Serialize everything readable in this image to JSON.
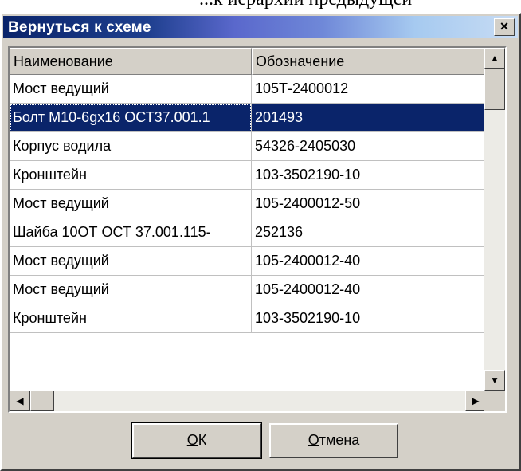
{
  "background_text": "...к иерархии предыдущей",
  "dialog": {
    "title": "Вернуться к схеме",
    "close_glyph": "×"
  },
  "table": {
    "columns": [
      "Наименование",
      "Обозначение"
    ],
    "rows": [
      {
        "name": "Мост ведущий",
        "code": "105Т-2400012"
      },
      {
        "name": "Болт М10-6gх16 ОСТ37.001.1",
        "code": "201493"
      },
      {
        "name": "Корпус водила",
        "code": "54326-2405030"
      },
      {
        "name": "Кронштейн",
        "code": "103-3502190-10"
      },
      {
        "name": "Мост ведущий",
        "code": "105-2400012-50"
      },
      {
        "name": "Шайба 10ОТ ОСТ 37.001.115-",
        "code": "252136"
      },
      {
        "name": "Мост ведущий",
        "code": "105-2400012-40"
      },
      {
        "name": "Мост ведущий",
        "code": "105-2400012-40"
      },
      {
        "name": "Кронштейн",
        "code": "103-3502190-10"
      }
    ],
    "selected_row": 1
  },
  "buttons": {
    "ok_mnemonic": "O",
    "ok_rest": "К",
    "cancel_mnemonic": "О",
    "cancel_rest": "тмена"
  },
  "icons": {
    "scroll_up": "▲",
    "scroll_down": "▼",
    "scroll_left": "◀",
    "scroll_right": "▶"
  },
  "colors": {
    "title_start": "#0a246a",
    "selection": "#0a246a",
    "face": "#d4d0c8"
  }
}
